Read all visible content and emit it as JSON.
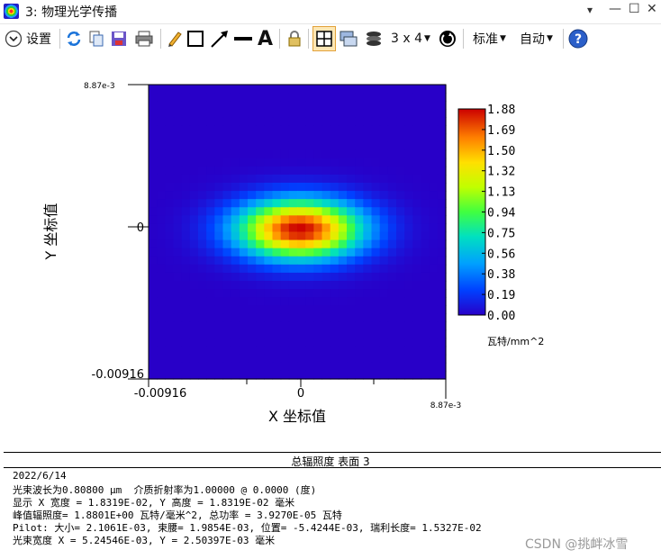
{
  "window": {
    "title": "3: 物理光学传播",
    "btn_dropdown": "▾",
    "btn_min": "—",
    "btn_max": "☐",
    "btn_close": "✕"
  },
  "toolbar": {
    "settings_label": "设置",
    "layout_label": "3 x 4",
    "standard_label": "标准",
    "auto_label": "自动",
    "icons": [
      "chevron-down-icon",
      "refresh-icon",
      "copy-icon",
      "save-icon",
      "print-icon",
      "pencil-icon",
      "rectangle-icon",
      "arrow-icon",
      "line-icon",
      "text-icon",
      "lock-icon",
      "grid-layout-icon",
      "windows-icon",
      "layers-icon",
      "clock-icon",
      "help-icon"
    ]
  },
  "chart_data": {
    "type": "heatmap",
    "title": "",
    "xlabel": "X 坐标值",
    "ylabel": "Y 坐标值",
    "x_tick_labels": [
      "-0.00916",
      "0",
      "8.87e-3"
    ],
    "y_tick_labels": [
      "8.87e-3",
      "0",
      "-0.00916"
    ],
    "xlim": [
      -0.00916,
      0.00887
    ],
    "ylim": [
      -0.00916,
      0.00887
    ],
    "peak": 1.88,
    "beam_width_x": 0.00524546,
    "beam_width_y": 0.00250397,
    "colorbar": {
      "ticks": [
        "1.88",
        "1.69",
        "1.50",
        "1.32",
        "1.13",
        "0.94",
        "0.75",
        "0.56",
        "0.38",
        "0.19",
        "0.00"
      ],
      "unit": "瓦特/mm^2",
      "range": [
        0.0,
        1.88
      ]
    },
    "colors": {
      "low": "#2800c8",
      "high": "#cc0000"
    }
  },
  "panel": {
    "title": "总辐照度 表面 3",
    "lines": [
      "2022/6/14",
      "光束波长为0.80800 μm  介质折射率为1.00000 @ 0.0000 (度)",
      "显示 X 宽度 = 1.8319E-02, Y 高度 = 1.8319E-02 毫米",
      "峰值辐照度= 1.8801E+00 瓦特/毫米^2, 总功率 = 3.9270E-05 瓦特",
      "Pilot: 大小= 2.1061E-03, 束腰= 1.9854E-03, 位置= -5.4244E-03, 瑞利长度= 1.5327E-02",
      "光束宽度 X = 5.24546E-03, Y = 2.50397E-03 毫米"
    ]
  },
  "watermark": "CSDN @挑衅冰雪"
}
